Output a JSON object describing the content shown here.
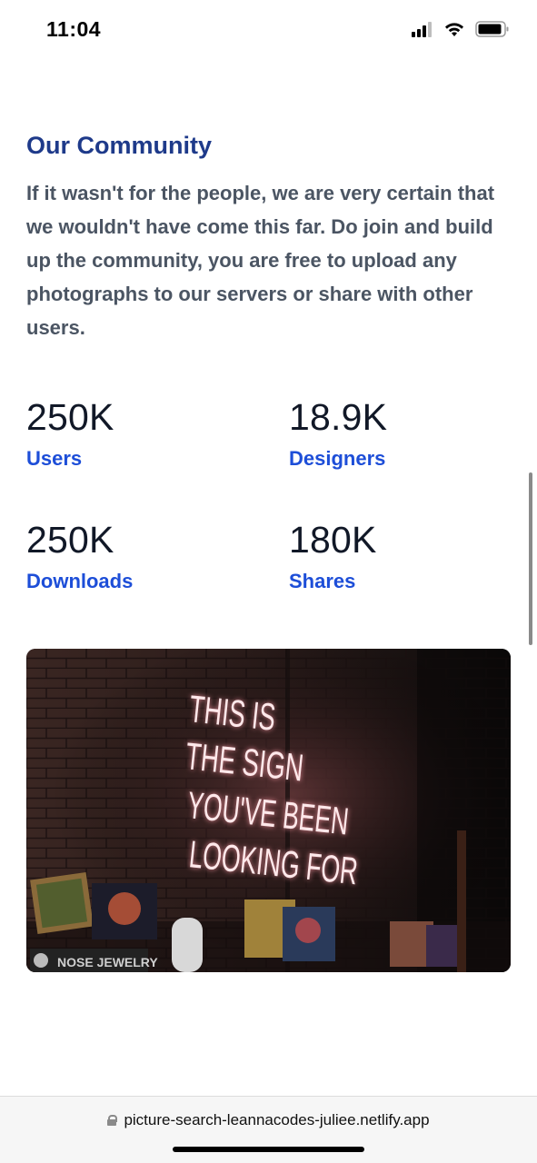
{
  "status_bar": {
    "time": "11:04",
    "icons": [
      "signal-icon",
      "wifi-icon",
      "battery-icon"
    ]
  },
  "community": {
    "title": "Our Community",
    "body": "If it wasn't for the people, we are very certain that we wouldn't have come this far. Do join and build up the community, you are free to upload any photographs to our servers or share with other users."
  },
  "stats": [
    {
      "value": "250K",
      "label": "Users"
    },
    {
      "value": "18.9K",
      "label": "Designers"
    },
    {
      "value": "250K",
      "label": "Downloads"
    },
    {
      "value": "180K",
      "label": "Shares"
    }
  ],
  "image": {
    "neon_lines": [
      "THIS IS",
      "THE SIGN",
      "YOU'VE BEEN",
      "LOOKING FOR"
    ],
    "sticker_text": "NOSE JEWELRY"
  },
  "browser": {
    "url": "picture-search-leannacodes-juliee.netlify.app"
  },
  "colors": {
    "title": "#1e3a8a",
    "body": "#4b5563",
    "stat_value": "#111827",
    "stat_label": "#1d4ed8"
  }
}
